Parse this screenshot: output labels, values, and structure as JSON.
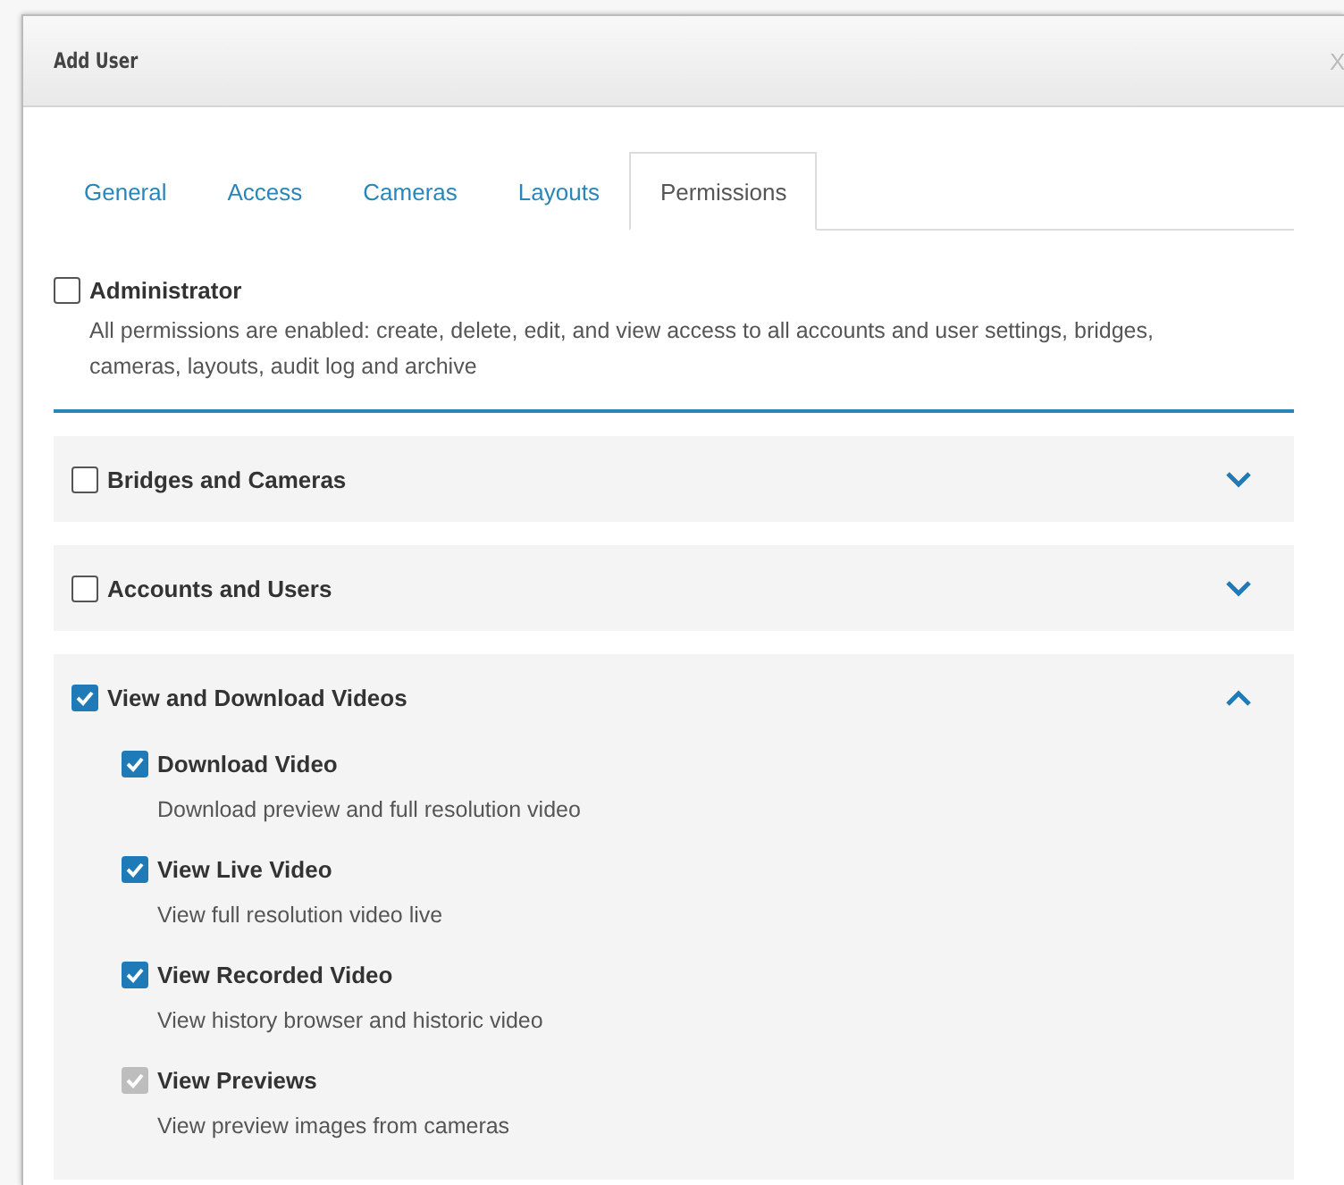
{
  "window": {
    "title": "Add User",
    "close": "X"
  },
  "tabs": [
    {
      "label": "General",
      "selected": false
    },
    {
      "label": "Access",
      "selected": false
    },
    {
      "label": "Cameras",
      "selected": false
    },
    {
      "label": "Layouts",
      "selected": false
    },
    {
      "label": "Permissions",
      "selected": true
    }
  ],
  "administrator": {
    "label": "Administrator",
    "checked": false,
    "description": "All permissions are enabled: create, delete, edit, and view access to all accounts and user settings, bridges, cameras, layouts, audit log and archive"
  },
  "sections": [
    {
      "label": "Bridges and Cameras",
      "checked": false,
      "expanded": false
    },
    {
      "label": "Accounts and Users",
      "checked": false,
      "expanded": false
    },
    {
      "label": "View and Download Videos",
      "checked": true,
      "expanded": true,
      "children": [
        {
          "label": "Download Video",
          "checked": true,
          "disabled": false,
          "description": "Download preview and full resolution video"
        },
        {
          "label": "View Live Video",
          "checked": true,
          "disabled": false,
          "description": "View full resolution video live"
        },
        {
          "label": "View Recorded Video",
          "checked": true,
          "disabled": false,
          "description": "View history browser and historic video"
        },
        {
          "label": "View Previews",
          "checked": true,
          "disabled": true,
          "description": "View preview images from cameras"
        }
      ]
    }
  ]
}
